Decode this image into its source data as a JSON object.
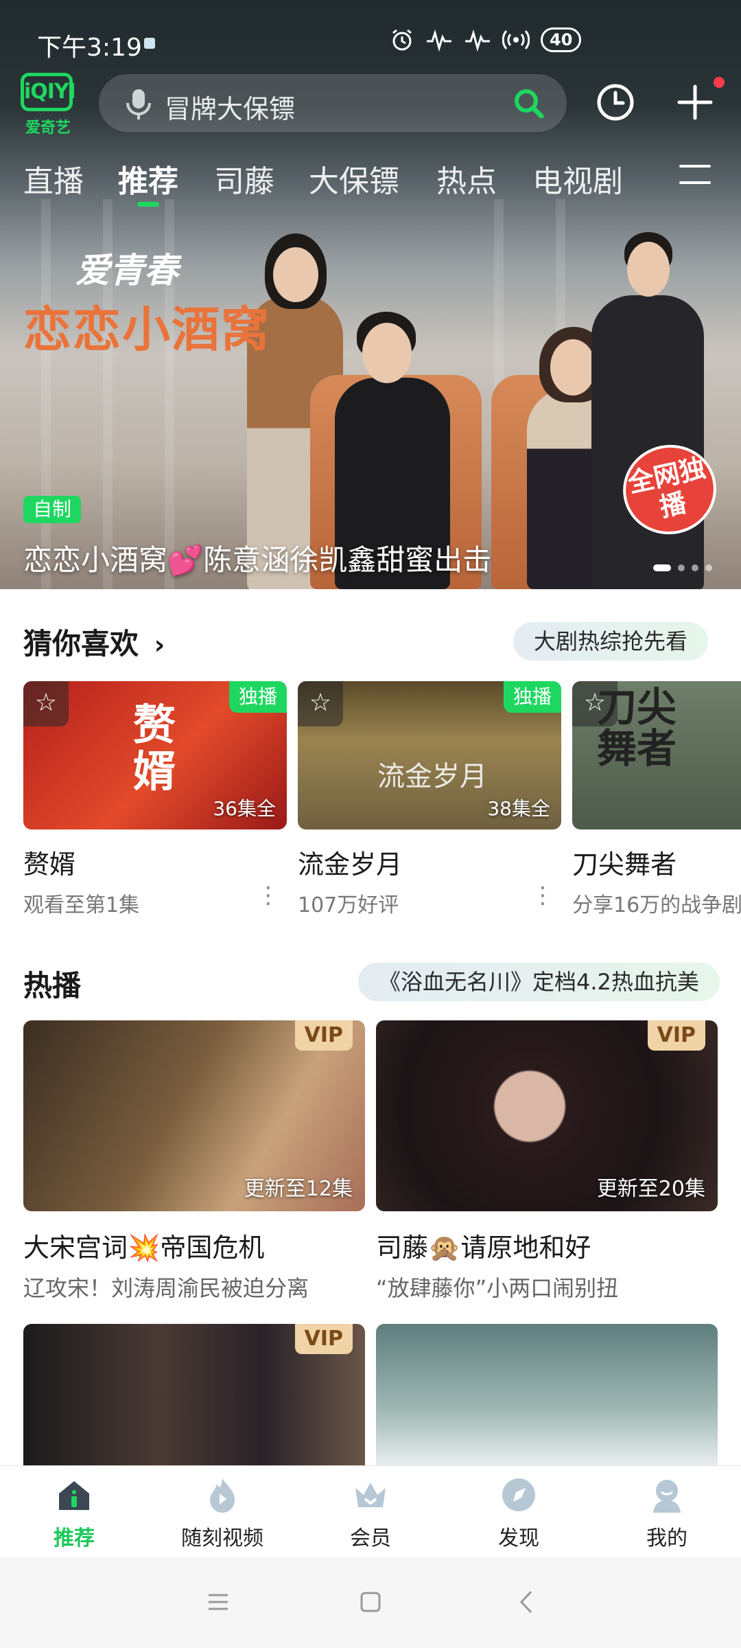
{
  "status_bar": {
    "time": "下午3:19",
    "battery": "40"
  },
  "header": {
    "logo_mark": "iQIYI",
    "logo_text": "爱奇艺",
    "search_placeholder": "冒牌大保镖"
  },
  "channel_tabs": [
    {
      "label": "直播"
    },
    {
      "label": "推荐"
    },
    {
      "label": "司藤"
    },
    {
      "label": "大保镖"
    },
    {
      "label": "热点"
    },
    {
      "label": "电视剧"
    }
  ],
  "hero": {
    "logo_line1": "爱青春",
    "logo_line2": "恋恋小酒窝",
    "badge": "全网独播",
    "tag": "自制",
    "caption": "恋恋小酒窝💕陈意涵徐凯鑫甜蜜出击"
  },
  "guess_section": {
    "title": "猜你喜欢",
    "pill": "大剧热综抢先看",
    "cards": [
      {
        "title": "赘婿",
        "sub": "观看至第1集",
        "badge": "独播",
        "count": "36集全",
        "art_title": "赘婿"
      },
      {
        "title": "流金岁月",
        "sub": "107万好评",
        "badge": "独播",
        "count": "38集全",
        "art_title": "流金岁月"
      },
      {
        "title": "刀尖舞者",
        "sub": "分享16万的战争剧",
        "badge": "",
        "count": "",
        "art_title": "刀尖舞者"
      }
    ]
  },
  "hot_section": {
    "title": "热播",
    "pill": "《浴血无名川》定档4.2热血抗美",
    "cards": [
      {
        "title": "大宋宫词💥帝国危机",
        "sub": "辽攻宋！刘涛周渝民被迫分离",
        "vip": "VIP",
        "update": "更新至12集"
      },
      {
        "title": "司藤🙊请原地和好",
        "sub": "“放肆藤你”小两口闹别扭",
        "vip": "VIP",
        "update": "更新至20集"
      },
      {
        "title": "",
        "sub": "",
        "vip": "VIP",
        "update": ""
      },
      {
        "title": "",
        "sub": "",
        "vip": "",
        "update": ""
      }
    ]
  },
  "bottom_nav": [
    {
      "label": "推荐"
    },
    {
      "label": "随刻视频"
    },
    {
      "label": "会员"
    },
    {
      "label": "发现"
    },
    {
      "label": "我的"
    }
  ],
  "colors": {
    "brand_green": "#1ED760",
    "vip_gold": "#F0D3A6"
  }
}
